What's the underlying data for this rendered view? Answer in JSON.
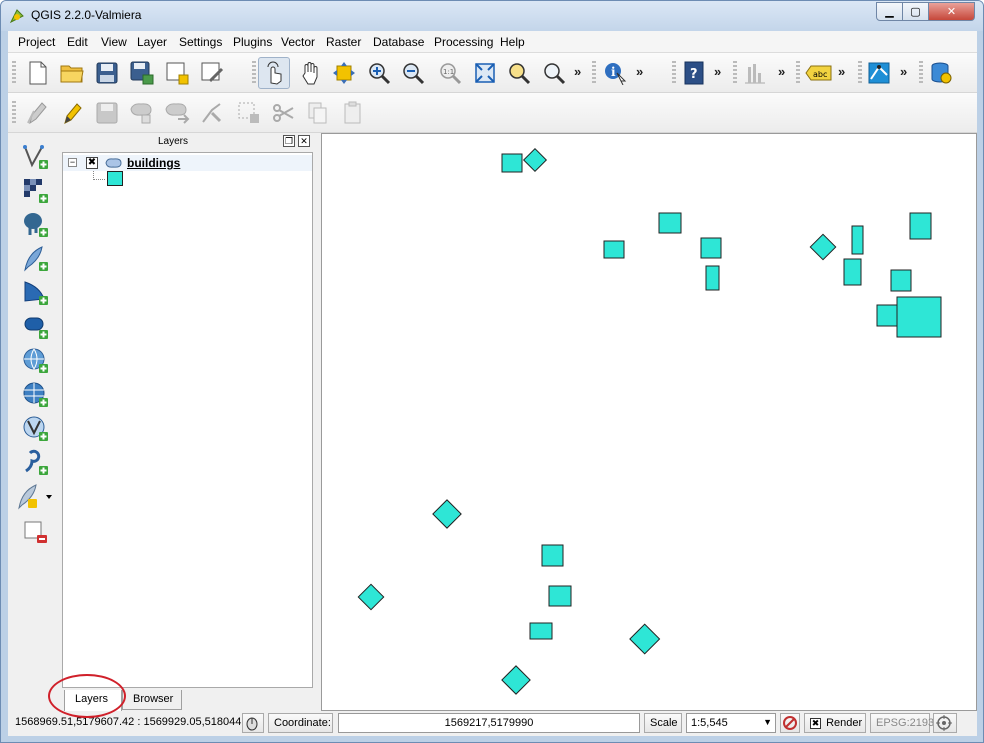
{
  "window": {
    "title": "QGIS 2.2.0-Valmiera"
  },
  "menu": [
    "Project",
    "Edit",
    "View",
    "Layer",
    "Settings",
    "Plugins",
    "Vector",
    "Raster",
    "Database",
    "Processing",
    "Help"
  ],
  "toolbar": {
    "chevron": "»",
    "abc_label": "abc"
  },
  "layers_panel": {
    "title": "Layers",
    "layer_name": "buildings",
    "symbol_color": "#2ee6d6",
    "tabs": {
      "layers": "Layers",
      "browser": "Browser"
    }
  },
  "statusbar": {
    "extents": "1568969.51,5179607.42 : 1569929.05,518044",
    "coordinate_label": "Coordinate:",
    "coordinate_value": "1569217,5179990",
    "scale_label": "Scale",
    "scale_value": "1:5,545",
    "render_label": "Render",
    "crs": "EPSG:2193"
  },
  "colors": {
    "feature_fill": "#2ee6d6",
    "feature_stroke": "#222222",
    "annotation": "#d0202a"
  }
}
